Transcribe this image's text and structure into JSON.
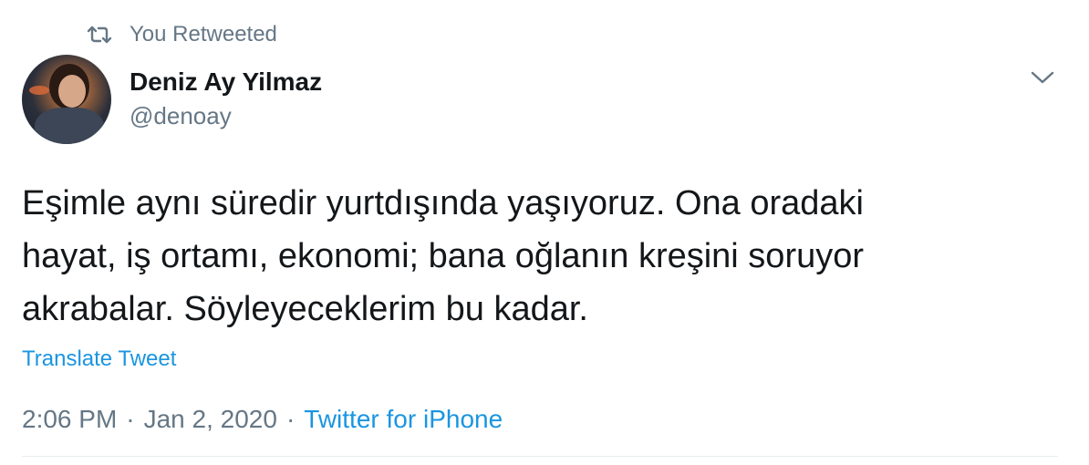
{
  "retweet": {
    "label": "You Retweeted",
    "icon": "retweet-icon"
  },
  "author": {
    "name": "Deniz Ay Yilmaz",
    "handle": "@denoay",
    "avatar_icon": "avatar"
  },
  "tweet": {
    "text": "Eşimle aynı süredir yurtdışında yaşıyoruz. Ona oradaki\nhayat, iş ortamı, ekonomi; bana oğlanın kreşini soruyor\nakrabalar. Söyleyeceklerim bu kadar.",
    "translate_label": "Translate Tweet",
    "time": "2:06 PM",
    "date": "Jan 2, 2020",
    "separator": "·",
    "source": "Twitter for iPhone"
  },
  "menu": {
    "icon": "chevron-down-icon"
  },
  "colors": {
    "link": "#1b95e0",
    "muted": "#657786",
    "text": "#14171a",
    "divider": "#e6ecf0"
  }
}
